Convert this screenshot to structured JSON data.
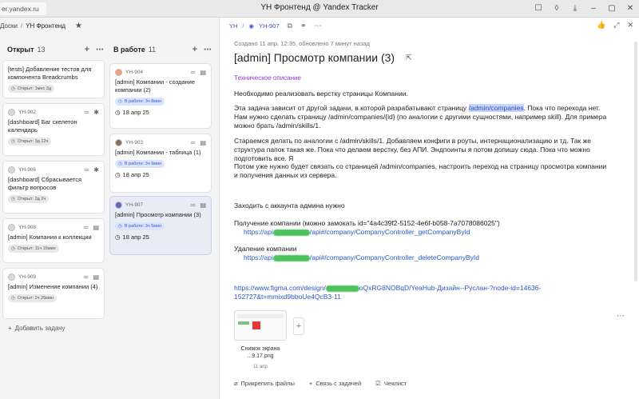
{
  "browser": {
    "url": "er.yandex.ru",
    "window_title": "YH Фронтенд @ Yandex Tracker"
  },
  "breadcrumb": {
    "item1": "Доски",
    "sep": "/",
    "item2": "YH Фронтенд"
  },
  "columns": [
    {
      "title": "Открыт",
      "count": "13",
      "cards": [
        {
          "key": "",
          "title": "[tests] Добавление тестов для компонента Breadcrumbs",
          "badge": "Открыт: 1мес 3д"
        },
        {
          "key": "YH-902",
          "title": "[dashboard] Баг скелетон календарь",
          "badge": "Открыт: 3д 12ч"
        },
        {
          "key": "YH-906",
          "title": "[dashboard] Сбрасывается фильтр вопросов",
          "badge": "Открыт: 2д 2ч"
        },
        {
          "key": "YH-908",
          "title": "[admin] Компания к коллекции",
          "badge": "Открыт: 11ч 16мин"
        },
        {
          "key": "YH-909",
          "title": "[admin] Изменение компании (4)",
          "badge": "Открыт: 2ч 26мин"
        }
      ],
      "add_task": "Добавить задачу"
    },
    {
      "title": "В работе",
      "count": "11",
      "cards": [
        {
          "key": "YH-904",
          "title": "[admin] Компании - создание компании (2)",
          "badge": "В работе: 3ч 8мин",
          "date": "18 апр 25"
        },
        {
          "key": "YH-903",
          "title": "[admin] Компании - таблица (1)",
          "badge": "В работе: 3ч 9мин",
          "date": "18 апр 25"
        },
        {
          "key": "YH-907",
          "title": "[admin] Просмотр компании (3)",
          "badge": "В работе: 3ч 5мин",
          "date": "18 апр 25"
        }
      ]
    }
  ],
  "detail": {
    "crumb_queue": "YH",
    "crumb_sep": "/",
    "crumb_key": "YH-907",
    "meta": "Создано 11 апр, 12:35, обновлено 7 минут назад",
    "title": "[admin] Просмотр компании (3)",
    "section": "Техническое описание",
    "p1": "Необходимо реализовать верстку страницы Компании.",
    "p2a": "Эта задача зависит от другой задачи, в которой разрабатывают страницу ",
    "p2_hl": "/admin/companies",
    "p2b": ". Пока что перехода нет. Нам нужно сделать страницу /admin/companies/{id} (по аналогии с другими сущностями, например skill). Для примера можно брать /admin/skills/1.",
    "p3": "Стараемся делать по аналогии с /admin/skills/1. Добавляем конфиги в роуты, интернационализацию и тд. Так же структура папок такая же. Пока что делаем верстку, без АПИ. Эндпоинты я потом допишу сюда. Пока что можно подготовить все. Я",
    "p4": "Потом уже нужно будет связать со страницей /admin/companies, настроить переход на страницу просмотра компании и получения данных из сервера.",
    "p5": "Заходить с аккаунта админа нужно",
    "p6": "Получение компании (можно замокать id=\"4a4c39f2-5152-4e6f-b058-7a7078086025\")",
    "link1a": "https://api",
    "link1b": "/api#/company/CompanyController_getCompanyById",
    "p7": "Удаление компании",
    "link2a": "https://api",
    "link2b": "/api#/company/CompanyController_deleteCompanyById",
    "link3a": "https://www.figma.com/design/",
    "link3b": "oQxRG8NOBqD/YeaHub-Дизайн--Руслан-?node-id=14636-152727&t=mmixd9bboUe4QcB3-11",
    "attachment_name": "Снимок экрана ...9.17.png",
    "attachment_date": "11 апр",
    "actions": [
      "Прикрепить файлы",
      "Связь с задачей",
      "Чеклист"
    ]
  }
}
